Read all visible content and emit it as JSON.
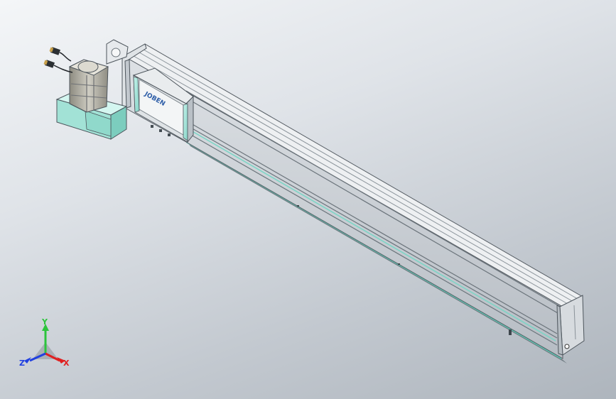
{
  "model": {
    "carriage_logo_text": "JOBEN"
  },
  "triad": {
    "x_label": "X",
    "y_label": "Y",
    "z_label": "Z",
    "colors": {
      "x": "#e02020",
      "y": "#2cc43c",
      "z": "#2040e0"
    }
  },
  "colors": {
    "background_top": "#f4f6f8",
    "background_bottom": "#aeb5bd",
    "rail_body": "#c9ced4",
    "rail_top": "#e8ebee",
    "accent_teal": "#a8e6dc",
    "motor_body": "#b9b7ac"
  }
}
